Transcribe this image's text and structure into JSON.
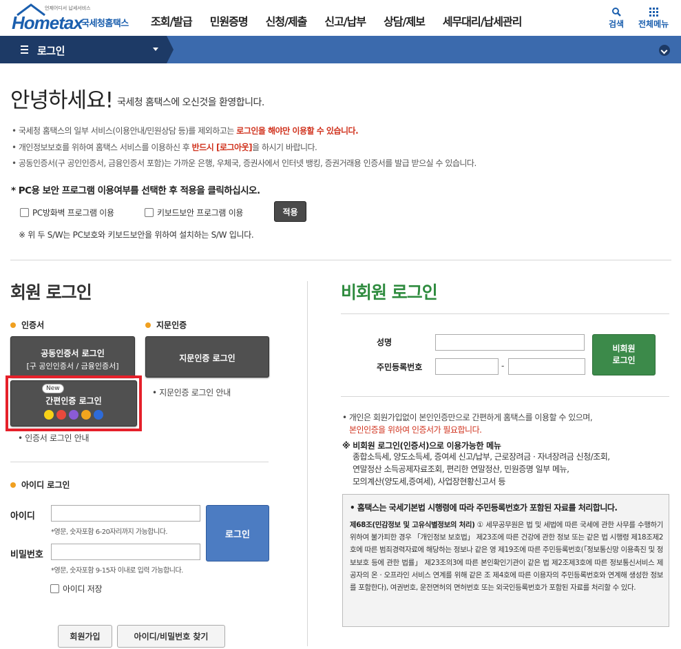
{
  "header": {
    "logo_text": "Hometax",
    "logo_sub": "국세청홈택스",
    "logo_tiny": "언제어디서 납세서비스",
    "gnb": [
      "조회/발급",
      "민원증명",
      "신청/제출",
      "신고/납부",
      "상담/제보",
      "세무대리/납세관리"
    ],
    "search_label": "검색",
    "menu_label": "전체메뉴"
  },
  "navbar": {
    "title": "로그인"
  },
  "greeting": {
    "title": "안녕하세요!",
    "subtitle": "국세청 홈택스에 오신것을 환영합니다."
  },
  "notices": {
    "n1_a": "• 국세청 홈택스의 일부 서비스(이용안내/민원상담 등)를 제외하고는 ",
    "n1_b": "로그인을 해야만 이용할 수 있습니다.",
    "n2_a": "• 개인정보보호를 위하여 홈택스 서비스를 이용하신 후 ",
    "n2_b": "반드시 [로그아웃]",
    "n2_c": "을 하시기 바랍니다.",
    "n3": "• 공동인증서(구 공인인증서, 금융인증서 포함)는 가까운 은행, 우체국, 증권사에서 인터넷 뱅킹, 증권거래용 인증서를 발급 받으실 수 있습니다."
  },
  "pc_security": {
    "title": "* PC용 보안 프로그램 이용여부를 선택한 후 적용을 클릭하십시오.",
    "option1": "PC방화벽 프로그램 이용",
    "option2": "키보드보안 프로그램 이용",
    "apply": "적용",
    "note": "※ 위 두 S/W는 PC보호와 키보드보안을 위하여 설치하는 S/W 입니다."
  },
  "member": {
    "title": "회원 로그인",
    "cert_label": "인증서",
    "finger_label": "지문인증",
    "joint_cert_line1": "공동인증서 로그인",
    "joint_cert_line2": "[구 공인인증서 / 금융인증서]",
    "finger_btn": "지문인증 로그인",
    "new_badge": "New",
    "simple_btn": "간편인증 로그인",
    "finger_guide": "• 지문인증 로그인 안내",
    "cert_guide": "• 인증서 로그인 안내",
    "id_login_label": "아이디 로그인",
    "id_label": "아이디",
    "id_hint": "*영문, 숫자포함 6-20자리까지 가능합니다.",
    "pw_label": "비밀번호",
    "pw_hint": "*영문, 숫자포함 9-15자 이내로 입력 가능합니다.",
    "login_btn": "로그인",
    "save_id": "아이디 저장",
    "join_btn": "회원가입",
    "find_btn": "아이디/비밀번호 찾기"
  },
  "nonmember": {
    "title": "비회원 로그인",
    "name_label": "성명",
    "rrn_label": "주민등록번호",
    "dash": "-",
    "login_btn_line1": "비회원",
    "login_btn_line2": "로그인",
    "info1": "• 개인은 회원가입없이 본인인증만으로 간편하게 홈택스를 이용할 수 있으며,",
    "info2": "본인인증을 위하여 인증서가 필요합니다.",
    "menu_title": "※ 비회원 로그인(인증서)으로 이용가능한 메뉴",
    "menu_list": "종합소득세, 양도소득세, 증여세 신고/납부, 근로장려금 · 자녀장려금 신청/조회,\n연말정산 소득공제자료조회, 편리한 연말정산, 민원증명 일부 메뉴,\n모의계산(양도세,증여세), 사업장현황신고서 등",
    "law_head": "• 홈택스는 국세기본법 시행령에 따라 주민등록번호가 포함된 자료를 처리합니다.",
    "law_bold": "제68조(민감정보 및 고유식별정보의 처리)",
    "law_text": " ① 세무공무원은 법 및 세법에 따른 국세에 관한 사무를 수행하기 위하여 불가피한 경우 「개인정보 보호법」 제23조에 따른 건강에 관한 정보 또는 같은 법 시행령 제18조제2호에 따른 범죄경력자료에 해당하는 정보나 같은 영 제19조에 따른 주민등록번호(「정보통신망 이용촉진 및 정보보호 등에 관한 법률」 제23조의3에 따른 본인확인기관이 같은 법 제2조제3호에 따른 정보통신서비스 제공자의 온 · 오프라인 서비스 연계를 위해 같은 조 제4호에 따른 이용자의 주민등록번호와 연계해 생성한 정보를 포함한다), 여권번호, 운전면허의 면허번호 또는 외국인등록번호가 포함된 자료를 처리할 수 있다."
  },
  "colors": {
    "brand_blue": "#1b5fae",
    "accent_red": "#d0321d",
    "nonmember_green": "#2e8b3e",
    "highlight_border": "#e5202a"
  }
}
